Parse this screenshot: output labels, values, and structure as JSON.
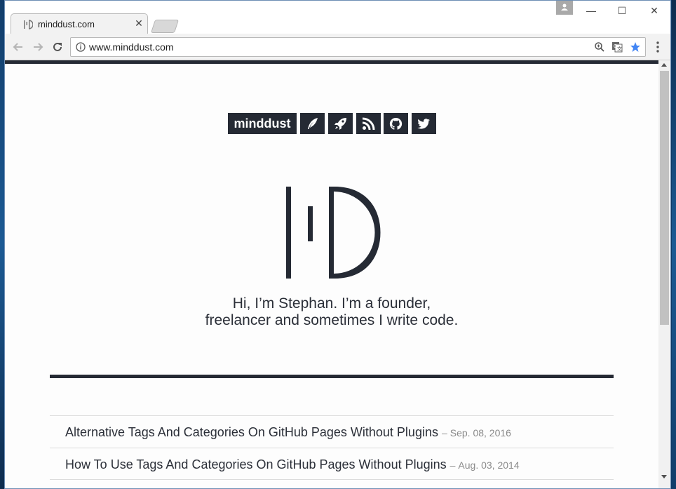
{
  "browser": {
    "tab": {
      "title": "minddust.com"
    },
    "address": {
      "url": "www.minddust.com"
    },
    "icons": [
      "back-icon",
      "forward-icon",
      "reload-icon",
      "info-icon",
      "zoom-icon",
      "translate-icon",
      "bookmark-star-icon",
      "menu-icon",
      "profile-icon",
      "minimize-icon",
      "maximize-icon",
      "close-icon"
    ]
  },
  "page": {
    "brand": "minddust",
    "nav_icons": [
      "quill-icon",
      "rocket-icon",
      "rss-icon",
      "github-icon",
      "twitter-icon"
    ],
    "logo_icon": "minddust-logo-icon",
    "intro": {
      "line1": "Hi, I’m Stephan. I’m a founder,",
      "line2": "freelancer and sometimes I write code."
    },
    "posts": [
      {
        "title": "Alternative Tags And Categories On GitHub Pages Without Plugins",
        "sep": "–",
        "date": "Sep. 08, 2016"
      },
      {
        "title": "How To Use Tags And Categories On GitHub Pages Without Plugins",
        "sep": "–",
        "date": "Aug. 03, 2014"
      }
    ]
  },
  "colors": {
    "accent_dark": "#252a34",
    "star_blue": "#4285f4"
  }
}
